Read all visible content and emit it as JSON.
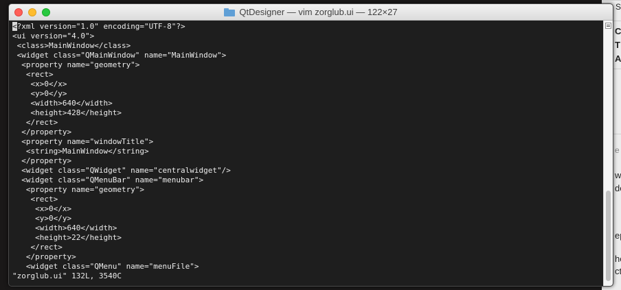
{
  "window": {
    "title": "QtDesigner — vim zorglub.ui — 122×27",
    "folder_icon": "folder-icon",
    "buttons": [
      "close",
      "minimize",
      "zoom"
    ]
  },
  "editor": {
    "lines": [
      "<?xml version=\"1.0\" encoding=\"UTF-8\"?>",
      "<ui version=\"4.0\">",
      " <class>MainWindow</class>",
      " <widget class=\"QMainWindow\" name=\"MainWindow\">",
      "  <property name=\"geometry\">",
      "   <rect>",
      "    <x>0</x>",
      "    <y>0</y>",
      "    <width>640</width>",
      "    <height>428</height>",
      "   </rect>",
      "  </property>",
      "  <property name=\"windowTitle\">",
      "   <string>MainWindow</string>",
      "  </property>",
      "  <widget class=\"QWidget\" name=\"centralwidget\"/>",
      "  <widget class=\"QMenuBar\" name=\"menubar\">",
      "   <property name=\"geometry\">",
      "    <rect>",
      "     <x>0</x>",
      "     <y>0</y>",
      "     <width>640</width>",
      "     <height>22</height>",
      "    </rect>",
      "   </property>",
      "   <widget class=\"QMenu\" name=\"menuFile\">"
    ],
    "status": "\"zorglub.ui\" 132L, 3540C"
  },
  "background_window": {
    "fragments": [
      "C",
      "T",
      "A",
      "e r",
      "w",
      "de",
      "ep",
      "he",
      "ct"
    ]
  },
  "colors": {
    "terminal_bg": "#1e1e1e",
    "terminal_text": "#ececec",
    "close": "#ff5f57",
    "minimize": "#febc2e",
    "zoom": "#28c840"
  }
}
